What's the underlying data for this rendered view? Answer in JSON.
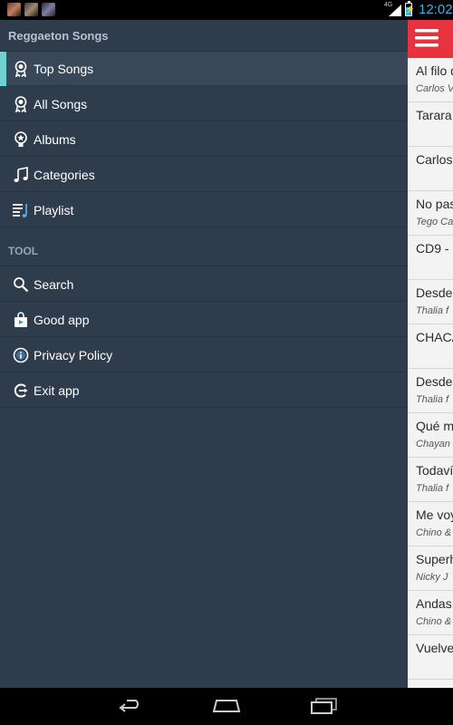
{
  "status_bar": {
    "network_type": "4G",
    "time": "12:02",
    "battery_level": 0.7,
    "notifications": [
      "album-art-notification-1",
      "album-art-notification-2",
      "album-art-notification-3"
    ]
  },
  "drawer": {
    "title": "Reggaeton Songs",
    "main_items": [
      {
        "label": "Top Songs",
        "icon": "award-ribbon-icon",
        "active": true
      },
      {
        "label": "All Songs",
        "icon": "award-ribbon-icon",
        "active": false
      },
      {
        "label": "Albums",
        "icon": "album-badge-icon",
        "active": false
      },
      {
        "label": "Categories",
        "icon": "music-note-icon",
        "active": false
      },
      {
        "label": "Playlist",
        "icon": "playlist-icon",
        "active": false
      }
    ],
    "tool_header": "TOOL",
    "tool_items": [
      {
        "label": "Search",
        "icon": "search-icon"
      },
      {
        "label": "Good app",
        "icon": "shopping-bag-icon"
      },
      {
        "label": "Privacy Policy",
        "icon": "info-icon"
      },
      {
        "label": "Exit app",
        "icon": "exit-icon"
      }
    ]
  },
  "content": {
    "header_color": "#e8323f",
    "songs": [
      {
        "title": "Al filo d",
        "artist": "Carlos V"
      },
      {
        "title": "Tarara",
        "artist": ""
      },
      {
        "title": "Carlos",
        "artist": ""
      },
      {
        "title": "No pas",
        "artist": "Tego Ca"
      },
      {
        "title": "CD9 - I",
        "artist": ""
      },
      {
        "title": "Desde",
        "artist": "Thalia f"
      },
      {
        "title": "CHACA",
        "artist": ""
      },
      {
        "title": "Desde",
        "artist": "Thalia f"
      },
      {
        "title": "Qué m",
        "artist": "Chayan"
      },
      {
        "title": "Todaví",
        "artist": "Thalia f"
      },
      {
        "title": "Me voy",
        "artist": "Chino &"
      },
      {
        "title": "Superh",
        "artist": "Nicky J"
      },
      {
        "title": "Andas",
        "artist": "Chino &"
      },
      {
        "title": "Vuelve",
        "artist": ""
      }
    ]
  },
  "colors": {
    "drawer_bg": "#2f3c4c",
    "active_item_bg": "#394858",
    "active_marker": "#6fd1d0",
    "status_time": "#33b5e5",
    "header_red": "#e8323f"
  },
  "nav_bar": {
    "buttons": [
      "back-icon",
      "home-icon",
      "recent-apps-icon"
    ]
  }
}
